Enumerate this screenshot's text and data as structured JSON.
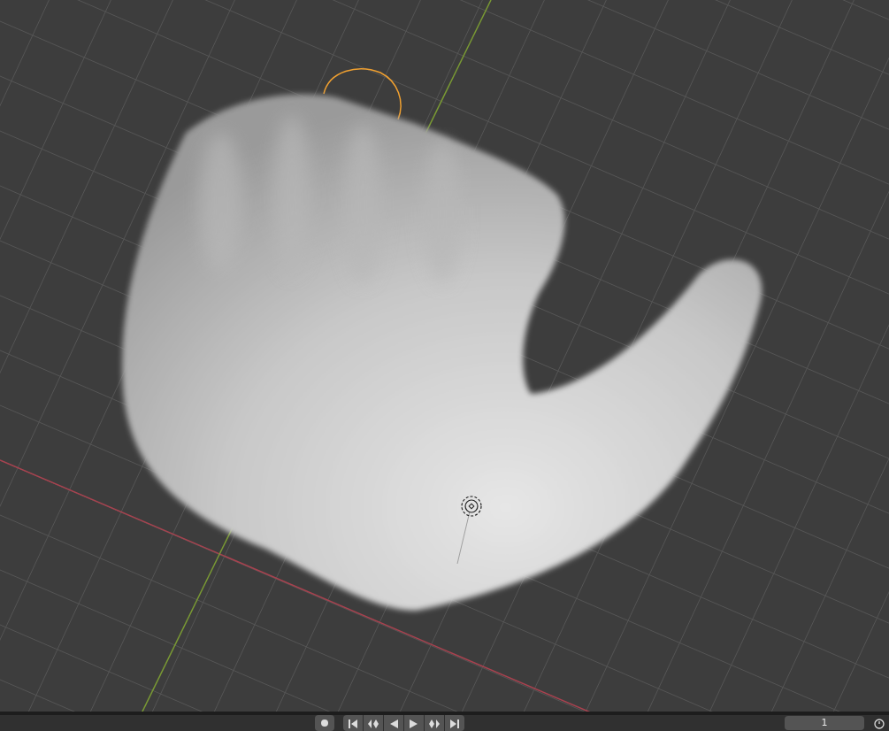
{
  "timeline": {
    "current_frame": "1"
  }
}
